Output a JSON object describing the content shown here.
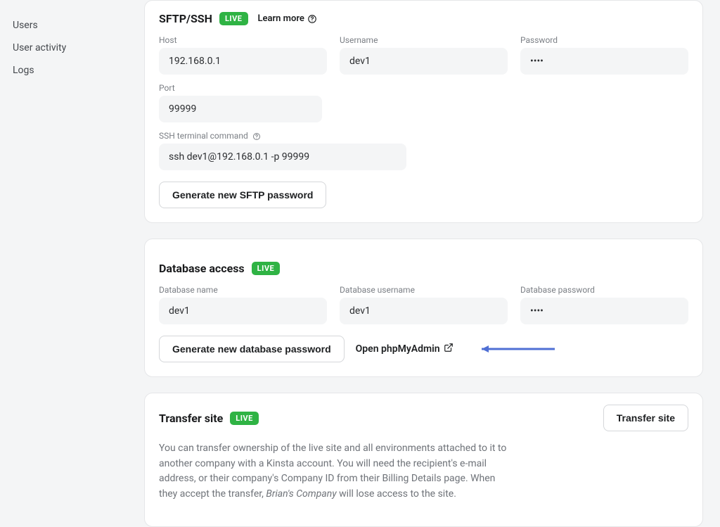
{
  "sidebar": {
    "items": [
      {
        "label": "Users"
      },
      {
        "label": "User activity"
      },
      {
        "label": "Logs"
      }
    ]
  },
  "sftp": {
    "title": "SFTP/SSH",
    "badge": "LIVE",
    "learn_more": "Learn more",
    "host_label": "Host",
    "host_value": "192.168.0.1",
    "username_label": "Username",
    "username_value": "dev1",
    "password_label": "Password",
    "password_value": "••••",
    "port_label": "Port",
    "port_value": "99999",
    "ssh_cmd_label": "SSH terminal command",
    "ssh_cmd_value": "ssh dev1@192.168.0.1 -p 99999",
    "generate_btn": "Generate new SFTP password"
  },
  "db": {
    "title": "Database access",
    "badge": "LIVE",
    "name_label": "Database name",
    "name_value": "dev1",
    "user_label": "Database username",
    "user_value": "dev1",
    "pass_label": "Database password",
    "pass_value": "••••",
    "generate_btn": "Generate new database password",
    "open_php": "Open phpMyAdmin"
  },
  "transfer": {
    "title": "Transfer site",
    "badge": "LIVE",
    "btn": "Transfer site",
    "desc_1": "You can transfer ownership of the live site and all environments attached to it to another company with a Kinsta account. You will need the recipient's e-mail address, or their company's Company ID from their Billing Details page. When they accept the transfer, ",
    "desc_em": "Brian's Company",
    "desc_2": " will lose access to the site."
  }
}
